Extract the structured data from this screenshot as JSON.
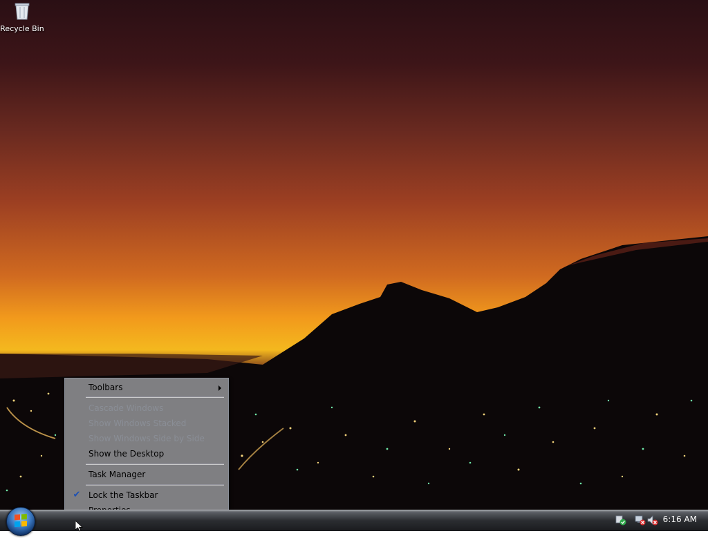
{
  "desktop": {
    "icons": [
      {
        "label": "Recycle Bin",
        "icon": "recycle-bin-icon"
      }
    ]
  },
  "context_menu": {
    "items": [
      {
        "label": "Toolbars",
        "enabled": true,
        "submenu": true
      },
      {
        "label": "Cascade Windows",
        "enabled": false
      },
      {
        "label": "Show Windows Stacked",
        "enabled": false
      },
      {
        "label": "Show Windows Side by Side",
        "enabled": false
      },
      {
        "label": "Show the Desktop",
        "enabled": true
      },
      {
        "label": "Task Manager",
        "enabled": true
      },
      {
        "label": "Lock the Taskbar",
        "enabled": true,
        "checked": true
      },
      {
        "label": "Properties",
        "enabled": true
      }
    ]
  },
  "taskbar": {
    "start_button": "windows-start-orb-icon",
    "tray_icons": [
      "security-shield-icon",
      "network-disconnected-icon",
      "volume-muted-icon"
    ],
    "clock": "6:16 AM"
  },
  "colors": {
    "sky_top": "#2a0f14",
    "sky_horizon": "#f4b81e",
    "accent_check": "#1b4fb5",
    "taskbar": "#1a1b1e"
  }
}
